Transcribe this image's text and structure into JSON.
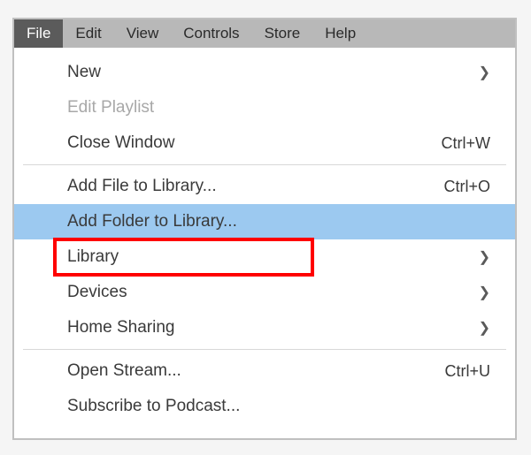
{
  "menubar": {
    "items": [
      {
        "label": "File",
        "active": true
      },
      {
        "label": "Edit"
      },
      {
        "label": "View"
      },
      {
        "label": "Controls"
      },
      {
        "label": "Store"
      },
      {
        "label": "Help"
      }
    ]
  },
  "dropdown": {
    "items": [
      {
        "label": "New",
        "submenu": true
      },
      {
        "label": "Edit Playlist",
        "disabled": true
      },
      {
        "label": "Close Window",
        "shortcut": "Ctrl+W"
      },
      {
        "separator": true
      },
      {
        "label": "Add File to Library...",
        "shortcut": "Ctrl+O"
      },
      {
        "label": "Add Folder to Library...",
        "highlighted": true
      },
      {
        "label": "Library",
        "submenu": true
      },
      {
        "label": "Devices",
        "submenu": true
      },
      {
        "label": "Home Sharing",
        "submenu": true
      },
      {
        "separator": true
      },
      {
        "label": "Open Stream...",
        "shortcut": "Ctrl+U"
      },
      {
        "label": "Subscribe to Podcast..."
      }
    ]
  }
}
